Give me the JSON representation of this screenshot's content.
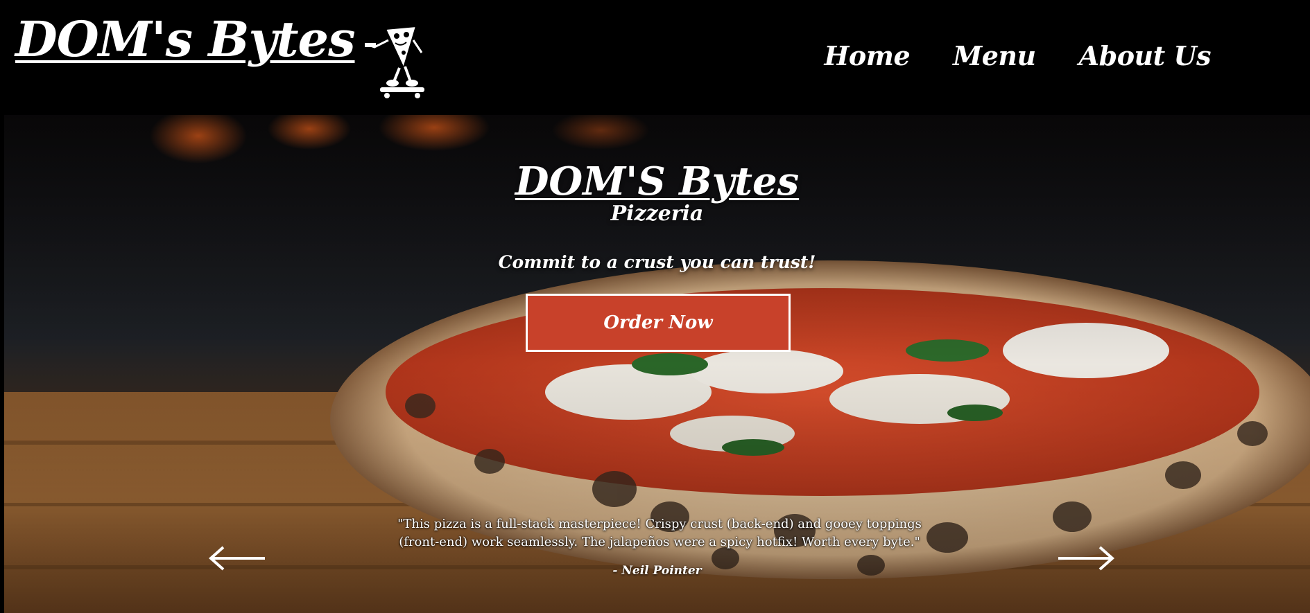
{
  "header": {
    "brand": "DOM's Bytes",
    "logo_icon": "pizza-slice-skateboard-mascot-icon",
    "nav": [
      {
        "label": "Home"
      },
      {
        "label": "Menu"
      },
      {
        "label": "About Us"
      }
    ]
  },
  "hero": {
    "title": "DOM'S Bytes",
    "subtitle": "Pizzeria",
    "tagline": "Commit to a crust you can trust!",
    "cta_label": "Order Now",
    "background_image": "wood-fired-margherita-pizza-photo"
  },
  "testimonial": {
    "quote": "\"This pizza is a full-stack masterpiece! Crispy crust (back-end) and gooey toppings (front-end) work seamlessly. The jalapeños were a spicy hotfix! Worth every byte.\"",
    "author": "- Neil Pointer",
    "prev_icon": "arrow-left-icon",
    "next_icon": "arrow-right-icon"
  },
  "colors": {
    "background": "#000000",
    "accent": "#c8412a",
    "text": "#ffffff"
  }
}
